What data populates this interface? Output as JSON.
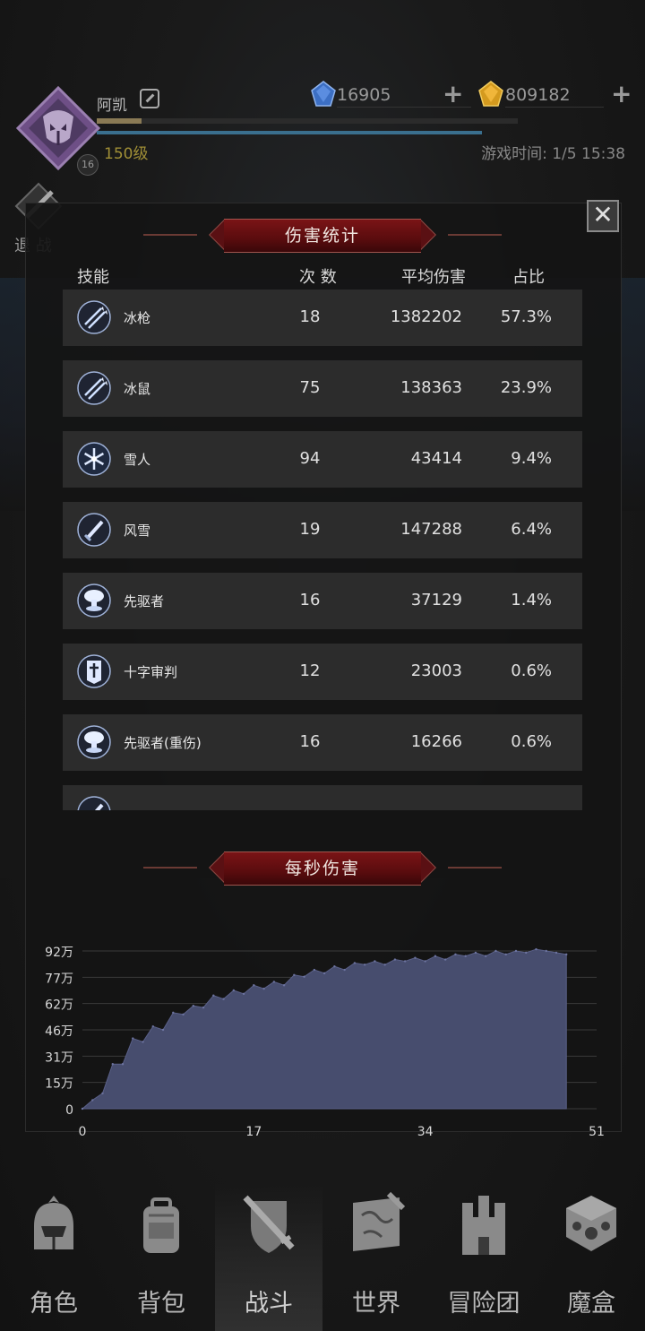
{
  "header": {
    "player_name": "阿凯",
    "player_level": "150级",
    "level_badge": "16",
    "gems": {
      "blue": "16905",
      "gold": "809182"
    },
    "game_time": "游戏时间: 1/5 15:38",
    "side_button_label": "退 战"
  },
  "damage_stats": {
    "title": "伤害统计",
    "close_icon": "✕",
    "columns": {
      "skill": "技能",
      "count": "次 数",
      "avg": "平均伤害",
      "share": "占比"
    },
    "rows": [
      {
        "icon": "double-spear-icon",
        "skill": "冰枪",
        "count": "18",
        "avg": "1382202",
        "share": "57.3%"
      },
      {
        "icon": "double-spear-icon",
        "skill": "冰鼠",
        "count": "75",
        "avg": "138363",
        "share": "23.9%"
      },
      {
        "icon": "snowflake-icon",
        "skill": "雪人",
        "count": "94",
        "avg": "43414",
        "share": "9.4%"
      },
      {
        "icon": "sword-icon",
        "skill": "风雪",
        "count": "19",
        "avg": "147288",
        "share": "6.4%"
      },
      {
        "icon": "mushroom-cloud-icon",
        "skill": "先驱者",
        "count": "16",
        "avg": "37129",
        "share": "1.4%"
      },
      {
        "icon": "cross-banner-icon",
        "skill": "十字审判",
        "count": "12",
        "avg": "23003",
        "share": "0.6%"
      },
      {
        "icon": "mushroom-cloud-icon",
        "skill": "先驱者(重伤)",
        "count": "16",
        "avg": "16266",
        "share": "0.6%"
      },
      {
        "icon": "sword-icon",
        "skill": "",
        "count": "",
        "avg": "",
        "share": ""
      }
    ]
  },
  "dps": {
    "title": "每秒伤害"
  },
  "chart_data": {
    "type": "area",
    "title": "每秒伤害",
    "xlabel": "",
    "ylabel": "",
    "x_ticks": [
      "0",
      "17",
      "34",
      "51"
    ],
    "y_ticks": [
      "0",
      "15万",
      "31万",
      "46万",
      "62万",
      "77万",
      "92万"
    ],
    "xlim": [
      0,
      51
    ],
    "ylim": [
      0,
      920000
    ],
    "fill_color": "#474d6e",
    "grid": true,
    "x": [
      0,
      1,
      2,
      3,
      4,
      5,
      6,
      7,
      8,
      9,
      10,
      11,
      12,
      13,
      14,
      15,
      16,
      17,
      18,
      19,
      20,
      21,
      22,
      23,
      24,
      25,
      26,
      27,
      28,
      29,
      30,
      31,
      32,
      33,
      34,
      35,
      36,
      37,
      38,
      39,
      40,
      41,
      42,
      43,
      44,
      45,
      46,
      47,
      48
    ],
    "y": [
      0,
      50000,
      90000,
      260000,
      260000,
      410000,
      390000,
      480000,
      460000,
      560000,
      550000,
      600000,
      590000,
      660000,
      640000,
      690000,
      670000,
      720000,
      700000,
      740000,
      720000,
      780000,
      770000,
      810000,
      790000,
      830000,
      810000,
      850000,
      840000,
      860000,
      840000,
      870000,
      860000,
      880000,
      860000,
      890000,
      870000,
      900000,
      890000,
      910000,
      890000,
      920000,
      900000,
      920000,
      910000,
      930000,
      920000,
      910000,
      900000
    ]
  },
  "bottom_nav": [
    {
      "icon": "helmet-icon",
      "label": "角色"
    },
    {
      "icon": "backpack-icon",
      "label": "背包"
    },
    {
      "icon": "sword-shield-icon",
      "label": "战斗"
    },
    {
      "icon": "world-map-icon",
      "label": "世界"
    },
    {
      "icon": "castle-icon",
      "label": "冒险团"
    },
    {
      "icon": "magic-cube-icon",
      "label": "魔盒"
    }
  ],
  "colors": {
    "ribbon": "#7a1416",
    "row_bg": "#2c2c2c",
    "level_gold": "#a08f36",
    "exp_blue": "#3a6f8e"
  }
}
